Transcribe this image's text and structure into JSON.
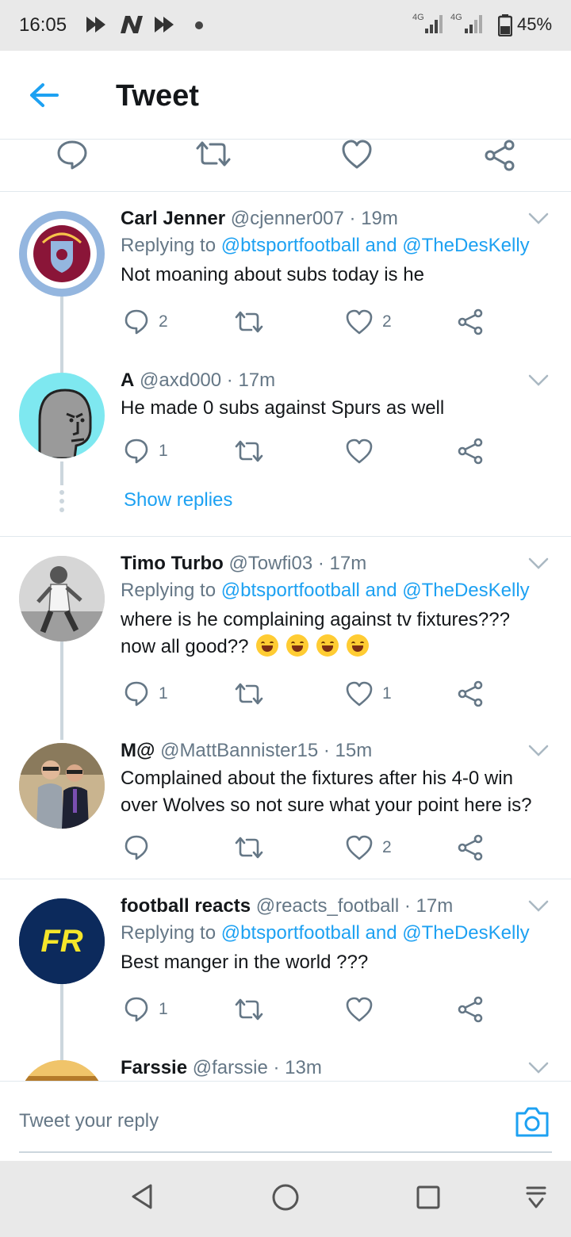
{
  "status_bar": {
    "time": "16:05",
    "battery": "45%",
    "network": "4G",
    "notification_icons": [
      "rewind-app-icon",
      "n-app-icon",
      "rewind-app-icon"
    ]
  },
  "header": {
    "title": "Tweet",
    "back_icon": "arrow-left-icon"
  },
  "colors": {
    "accent": "#1da1f2",
    "text": "#14171a",
    "muted": "#657786",
    "divider": "#e1e8ed"
  },
  "threads": [
    {
      "tweets": [
        {
          "name": "Carl Jenner",
          "handle": "@cjenner007",
          "time": "· 19m",
          "replying_prefix": "Replying to",
          "reply_to": "@btsportfootball and @TheDesKelly",
          "text": "Not moaning about subs today is he",
          "replies": "2",
          "retweets": "",
          "likes": "2"
        },
        {
          "name": "A",
          "handle": "@axd000",
          "time": "· 17m",
          "text": "He made 0 subs against Spurs as well",
          "replies": "1",
          "retweets": "",
          "likes": ""
        }
      ],
      "show_replies": "Show replies"
    },
    {
      "tweets": [
        {
          "name": "Timo Turbo",
          "handle": "@Towfi03",
          "time": "· 17m",
          "replying_prefix": "Replying to",
          "reply_to": "@btsportfootball and @TheDesKelly",
          "text_line1": "where is he complaining against tv fixtures???",
          "text_line2": "now all good??",
          "replies": "1",
          "retweets": "",
          "likes": "1"
        },
        {
          "name": "M@",
          "handle": "@MattBannister15",
          "time": "· 15m",
          "text": "Complained about the fixtures after his 4-0 win over Wolves so not sure what your point here is?",
          "replies": "",
          "retweets": "",
          "likes": "2"
        }
      ]
    },
    {
      "tweets": [
        {
          "name": "football reacts",
          "handle": "@reacts_football",
          "time": "· 17m",
          "replying_prefix": "Replying to",
          "reply_to": "@btsportfootball and @TheDesKelly",
          "text": "Best manger in the world ???",
          "avatar_text": "FR",
          "replies": "1",
          "retweets": "",
          "likes": ""
        },
        {
          "name": "Farssie",
          "handle": "@farssie",
          "time": "· 13m"
        }
      ]
    }
  ],
  "compose": {
    "placeholder": "Tweet your reply",
    "camera_icon": "camera-icon"
  },
  "nav": {
    "icons": [
      "back-triangle-icon",
      "home-circle-icon",
      "recents-square-icon",
      "notification-pulldown-icon"
    ]
  }
}
